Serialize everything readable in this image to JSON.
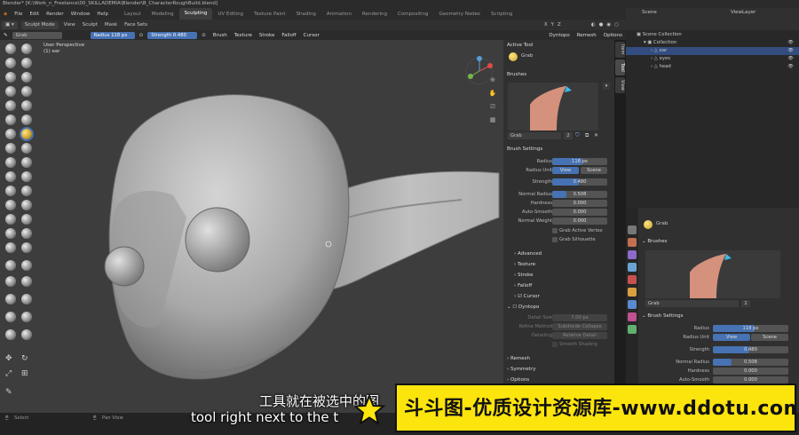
{
  "window": {
    "title": "Blender* [K:\\Work_n_Freelance\\00_SKILLADEMIA\\Blender\\B_CharacterRoughBuild.blend]"
  },
  "menubar": {
    "menus": [
      "File",
      "Edit",
      "Render",
      "Window",
      "Help"
    ],
    "workspaces": [
      "Layout",
      "Modeling",
      "Sculpting",
      "UV Editing",
      "Texture Paint",
      "Shading",
      "Animation",
      "Rendering",
      "Compositing",
      "Geometry Nodes",
      "Scripting"
    ],
    "active_workspace": "Sculpting"
  },
  "viewport_header": {
    "mode": "Sculpt Mode",
    "menus": [
      "View",
      "Sculpt",
      "Mask",
      "Face Sets"
    ],
    "dyntopo": "Dyntopo",
    "remesh": "Remesh",
    "options": "Options",
    "axes": [
      "X",
      "Y",
      "Z"
    ]
  },
  "tool_header": {
    "brush": "Grab",
    "radius_label": "Radius",
    "radius_value": "118 px",
    "strength_label": "Strength",
    "strength_value": "0.480",
    "menus": [
      "Brush",
      "Texture",
      "Stroke",
      "Falloff",
      "Cursor"
    ]
  },
  "viewport": {
    "perspective": "User Perspective",
    "object": "(1) ear"
  },
  "sidebar_tabs": [
    "Item",
    "Tool",
    "View"
  ],
  "npanel": {
    "active_tool_header": "Active Tool",
    "active_tool": "Grab",
    "brushes_header": "Brushes",
    "brush_name": "Grab",
    "brush_users": "2",
    "brush_settings_header": "Brush Settings",
    "radius": {
      "label": "Radius",
      "value": "118 px",
      "fill": 0.55
    },
    "radius_unit": {
      "label": "Radius Unit",
      "view": "View",
      "scene": "Scene"
    },
    "strength": {
      "label": "Strength",
      "value": "0.480",
      "fill": 0.48
    },
    "normal_radius": {
      "label": "Normal Radius",
      "value": "0.508",
      "fill": 0.25
    },
    "hardness": {
      "label": "Hardness",
      "value": "0.000"
    },
    "auto_smooth": {
      "label": "Auto-Smooth",
      "value": "0.000"
    },
    "normal_weight": {
      "label": "Normal Weight",
      "value": "0.000"
    },
    "grab_active_vertex": "Grab Active Vertex",
    "grab_silhouette": "Grab Silhouette",
    "subsections": [
      "Advanced",
      "Texture",
      "Stroke",
      "Falloff",
      "Cursor"
    ],
    "dyntopo_header": "Dyntopo",
    "detail_size": {
      "label": "Detail Size",
      "value": "7.00 px"
    },
    "refine_method": {
      "label": "Refine Method",
      "value": "Subdivide Collapse"
    },
    "detailing": {
      "label": "Detailing",
      "value": "Relative Detail"
    },
    "smooth_shading": "Smooth Shading",
    "remesh_header": "Remesh",
    "symmetry_header": "Symmetry",
    "options_header": "Options"
  },
  "outliner": {
    "scene_label": "Scene",
    "view_layer_label": "ViewLayer",
    "rows": [
      {
        "name": "Scene Collection",
        "indent": 0
      },
      {
        "name": "Collection",
        "indent": 1
      },
      {
        "name": "ear",
        "indent": 2,
        "selected": true
      },
      {
        "name": "eyes",
        "indent": 2
      },
      {
        "name": "head",
        "indent": 2
      }
    ]
  },
  "properties": {
    "tool_name": "Grab",
    "brushes_header": "Brushes",
    "brush_name": "Grab",
    "brush_users": "2",
    "brush_settings_header": "Brush Settings",
    "radius": {
      "label": "Radius",
      "value": "118 px",
      "fill": 0.55
    },
    "radius_unit": {
      "label": "Radius Unit",
      "view": "View",
      "scene": "Scene"
    },
    "strength": {
      "label": "Strength",
      "value": "0.480",
      "fill": 0.48
    },
    "normal_radius": {
      "label": "Normal Radius",
      "value": "0.508",
      "fill": 0.25
    },
    "hardness": {
      "label": "Hardness",
      "value": "0.000"
    },
    "auto_smooth": {
      "label": "Auto-Smooth",
      "value": "0.000"
    }
  },
  "statusbar": {
    "select": "Select",
    "pan_view": "Pan View"
  },
  "subtitles": {
    "zh": "工具就在被选中的图",
    "en": "tool right next to the     t"
  },
  "watermark": {
    "text": "斗斗图-优质设计资源库-www.ddotu.com"
  },
  "colors": {
    "accent": "#4772b3",
    "watermark_bg": "#fce40d",
    "clay": "#b3b3b3"
  }
}
